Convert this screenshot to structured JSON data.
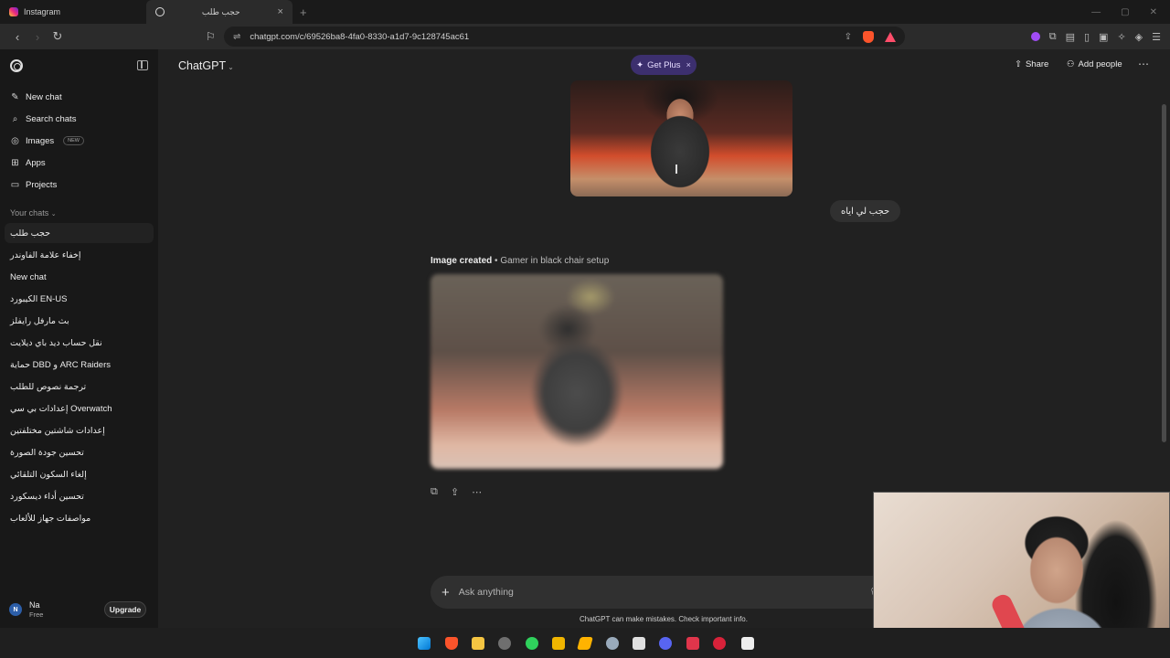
{
  "browser": {
    "tabs": [
      {
        "title": "Instagram"
      },
      {
        "title": "حجب طلب"
      }
    ],
    "new_tab": "+",
    "url": "chatgpt.com/c/69526ba8-4fa0-8330-a1d7-9c128745ac61"
  },
  "sidebar": {
    "nav": [
      {
        "label": "New chat",
        "icon": "edit-icon"
      },
      {
        "label": "Search chats",
        "icon": "search-icon"
      },
      {
        "label": "Images",
        "icon": "images-icon",
        "badge": "NEW"
      },
      {
        "label": "Apps",
        "icon": "apps-icon"
      },
      {
        "label": "Projects",
        "icon": "folder-icon"
      }
    ],
    "section_label": "Your chats",
    "chats": [
      "حجب طلب",
      "إخفاء علامة الفاوندر",
      "New chat",
      "الكيبورد EN-US",
      "بث مارفل رايفلز",
      "نقل حساب ديد باي ديلايت",
      "حماية DBD و ARC Raiders",
      "ترجمة نصوص للطلب",
      "إعدادات بي سي Overwatch",
      "إعدادات شاشتين مختلفتين",
      "تحسين جودة الصورة",
      "إلغاء السكون التلقائي",
      "تحسين أداء ديسكورد",
      "مواصفات جهاز للألعاب"
    ],
    "user": {
      "initial": "N",
      "name": "Na",
      "plan": "Free"
    },
    "upgrade_label": "Upgrade"
  },
  "header": {
    "model": "ChatGPT",
    "get_plus": "Get Plus",
    "share": "Share",
    "add_people": "Add people"
  },
  "conversation": {
    "user_message": "حجب لي اياه",
    "image_caption_bold": "Image created",
    "image_caption_rest": " • Gamer in black chair setup"
  },
  "composer": {
    "placeholder": "Ask anything",
    "disclaimer": "ChatGPT can make mistakes. Check important info."
  },
  "colors": {
    "sidebar_bg": "#181818",
    "main_bg": "#212121",
    "plus_pill": "#3c2f6e"
  }
}
